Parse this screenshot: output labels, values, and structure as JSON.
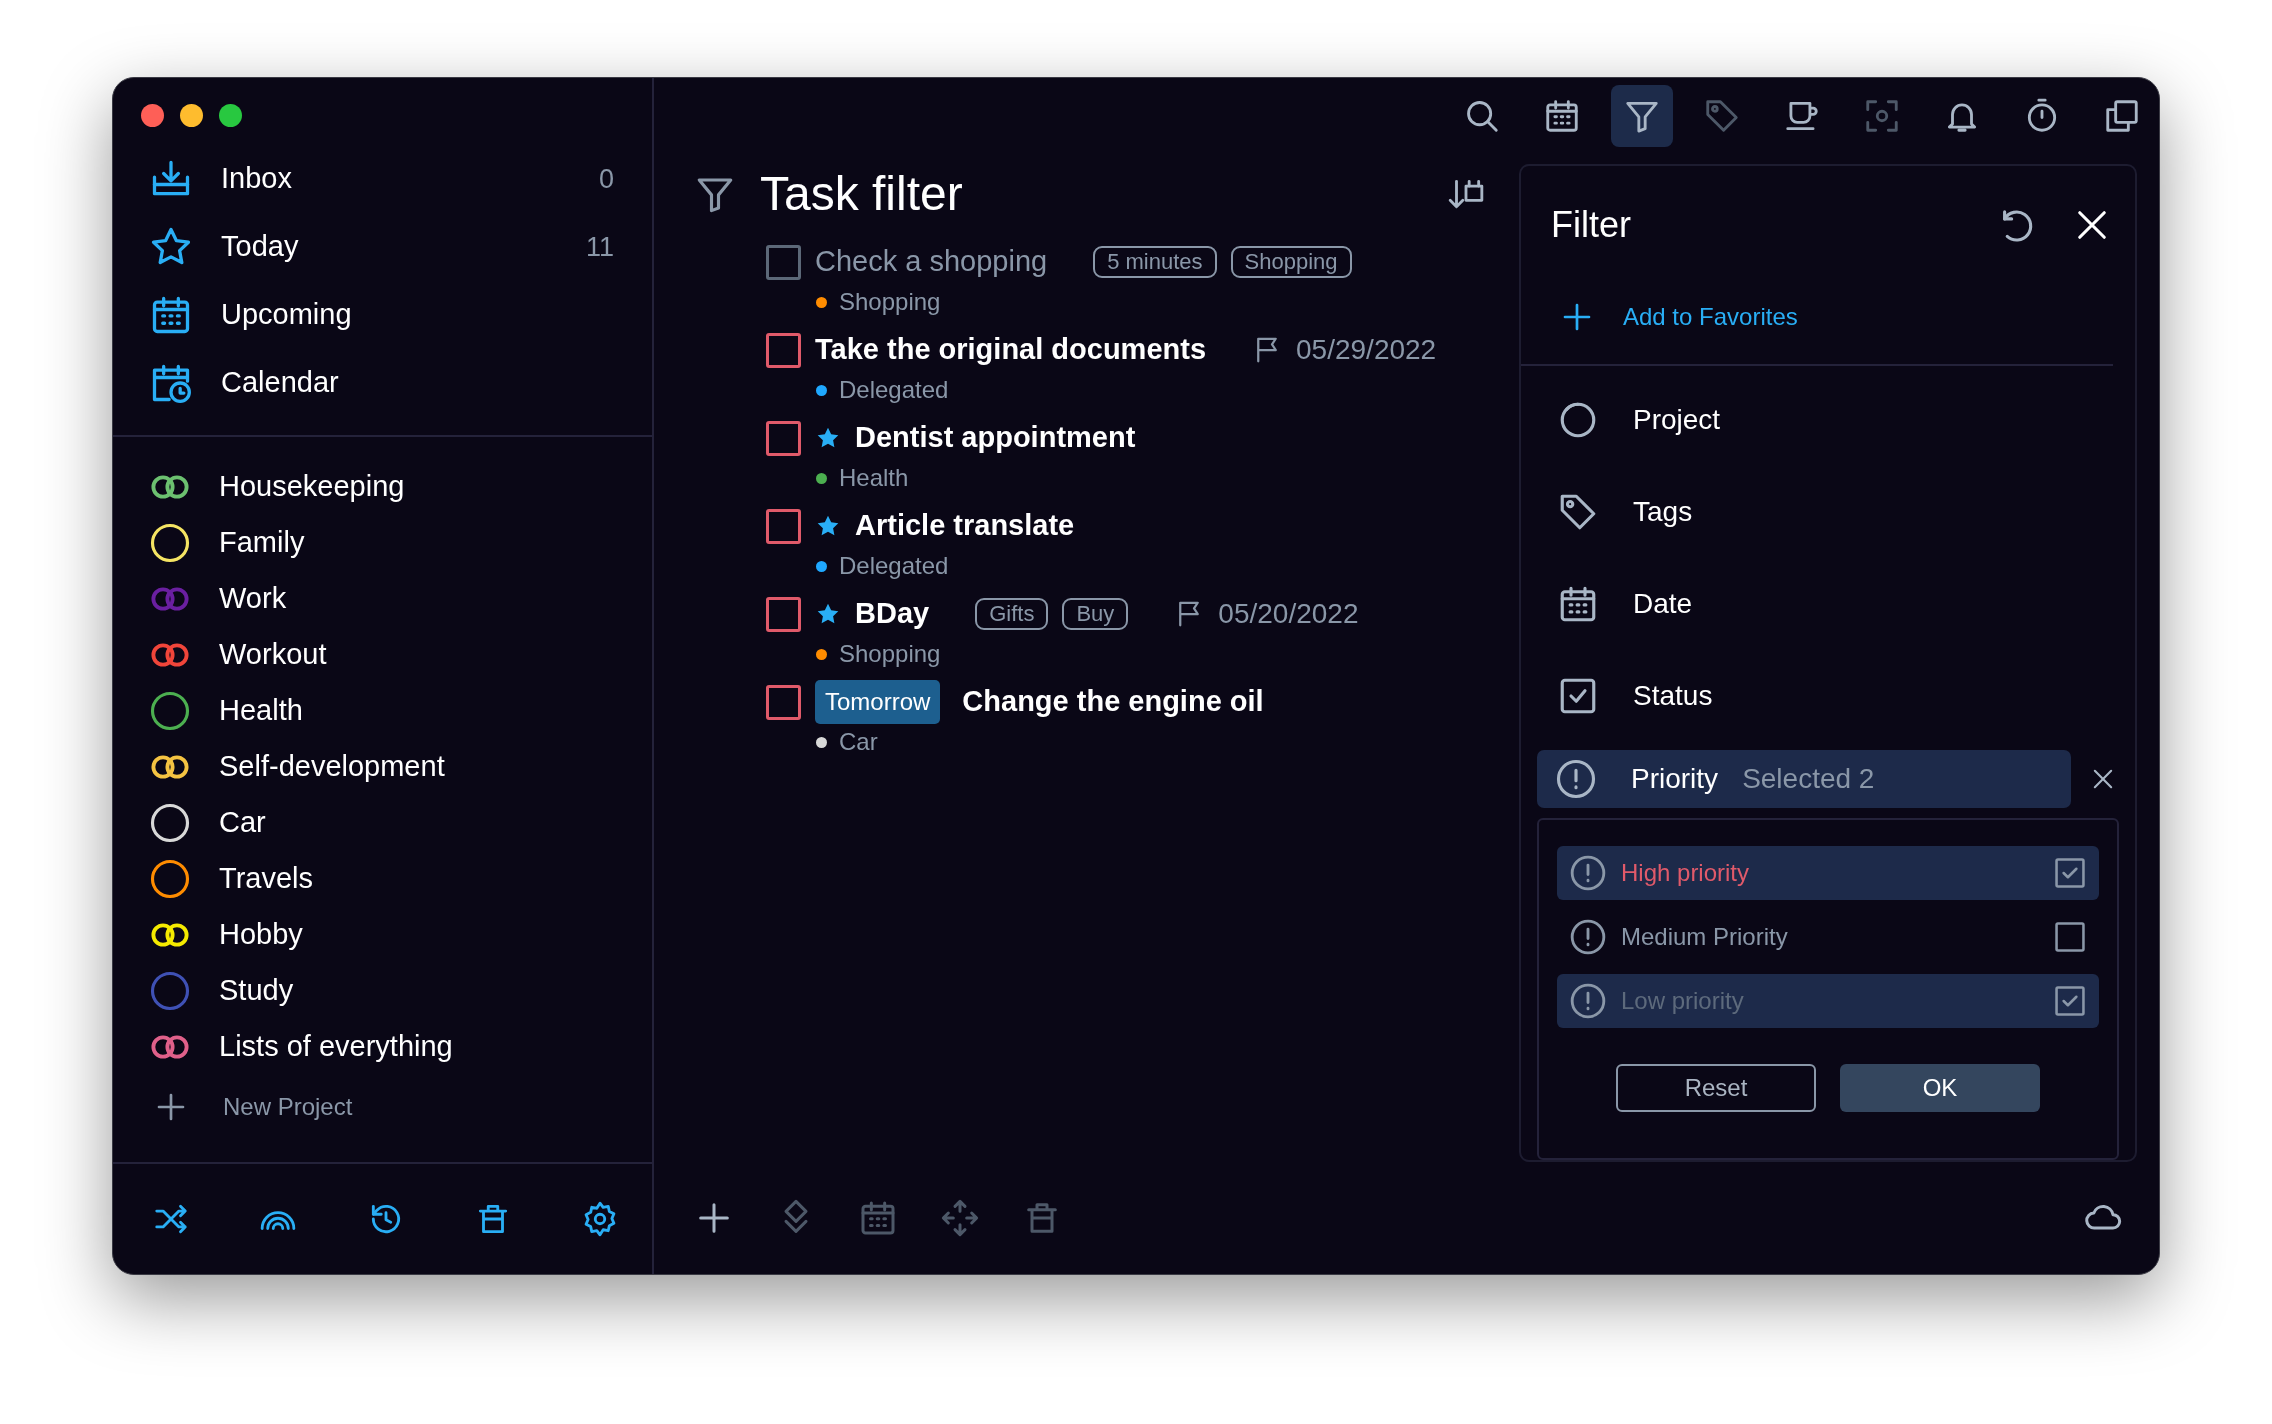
{
  "sidebar": {
    "nav": [
      {
        "label": "Inbox",
        "count": "0"
      },
      {
        "label": "Today",
        "count": "11"
      },
      {
        "label": "Upcoming"
      },
      {
        "label": "Calendar"
      }
    ],
    "projects": [
      {
        "label": "Housekeeping",
        "kind": "double",
        "color": "#6cc070"
      },
      {
        "label": "Family",
        "kind": "single",
        "color": "#f5e463"
      },
      {
        "label": "Work",
        "kind": "double",
        "color": "#6a1fa0"
      },
      {
        "label": "Workout",
        "kind": "double",
        "color": "#f0453a"
      },
      {
        "label": "Health",
        "kind": "single",
        "color": "#4caf50"
      },
      {
        "label": "Self-development",
        "kind": "double",
        "color": "#f5c342"
      },
      {
        "label": "Car",
        "kind": "single",
        "color": "#d8d8d8"
      },
      {
        "label": "Travels",
        "kind": "single",
        "color": "#ff8c00"
      },
      {
        "label": "Hobby",
        "kind": "double",
        "color": "#f5ea00"
      },
      {
        "label": "Study",
        "kind": "single",
        "color": "#3f51b5"
      },
      {
        "label": "Lists of everything",
        "kind": "double",
        "color": "#e0608a"
      }
    ],
    "new_project": "New Project"
  },
  "toolbar": [
    {
      "selected": false,
      "disabled": false
    },
    {
      "selected": false,
      "disabled": false
    },
    {
      "selected": true,
      "disabled": false
    },
    {
      "selected": false,
      "disabled": true
    },
    {
      "selected": false,
      "disabled": false
    },
    {
      "selected": false,
      "disabled": true
    },
    {
      "selected": false,
      "disabled": false
    },
    {
      "selected": false,
      "disabled": false
    },
    {
      "selected": false,
      "disabled": false
    }
  ],
  "main": {
    "title": "Task filter",
    "tasks": [
      {
        "title": "Check a shopping",
        "checkbox": {
          "color": "#5c6878"
        },
        "dimmed": true,
        "starred": false,
        "tags": [
          "5 minutes",
          "Shopping"
        ],
        "project": "Shopping",
        "color": "#ff8c00"
      },
      {
        "title": "Take the original documents",
        "checkbox": {
          "color": "#e05a6a"
        },
        "dimmed": false,
        "starred": false,
        "date": "05/29/2022",
        "project": "Delegated",
        "color": "#1fa8ff"
      },
      {
        "title": "Dentist appointment",
        "checkbox": {
          "color": "#e05a6a"
        },
        "dimmed": false,
        "starred": true,
        "project": "Health",
        "color": "#4caf50"
      },
      {
        "title": "Article translate",
        "checkbox": {
          "color": "#e05a6a"
        },
        "dimmed": false,
        "starred": true,
        "project": "Delegated",
        "color": "#1fa8ff"
      },
      {
        "title": "BDay",
        "checkbox": {
          "color": "#e05a6a"
        },
        "dimmed": false,
        "starred": true,
        "tags": [
          "Gifts",
          "Buy"
        ],
        "date": "05/20/2022",
        "project": "Shopping",
        "color": "#ff8c00"
      },
      {
        "title": "Change the engine oil",
        "checkbox": {
          "color": "#e05a6a"
        },
        "dimmed": false,
        "starred": false,
        "due_label": "Tomorrow",
        "project": "Car",
        "color": "#d8d8d8"
      }
    ],
    "bottom_toolbar": [
      {
        "disabled": false
      },
      {
        "disabled": true
      },
      {
        "disabled": true
      },
      {
        "disabled": true
      },
      {
        "disabled": true
      }
    ]
  },
  "filter": {
    "title": "Filter",
    "add_favorites": "Add to Favorites",
    "criteria": [
      {
        "label": "Project",
        "expanded": false
      },
      {
        "label": "Tags",
        "expanded": false
      },
      {
        "label": "Date",
        "expanded": false
      },
      {
        "label": "Status",
        "expanded": false
      },
      {
        "label": "Priority",
        "expanded": true,
        "summary": "Selected 2"
      }
    ],
    "options": [
      {
        "label": "High priority",
        "checked": true,
        "color": "#e05a6a"
      },
      {
        "label": "Medium Priority",
        "checked": false,
        "color": "#8a97a8"
      },
      {
        "label": "Low priority",
        "checked": true,
        "color": "#5d6a7c"
      }
    ],
    "buttons": [
      "Reset",
      "OK"
    ]
  }
}
